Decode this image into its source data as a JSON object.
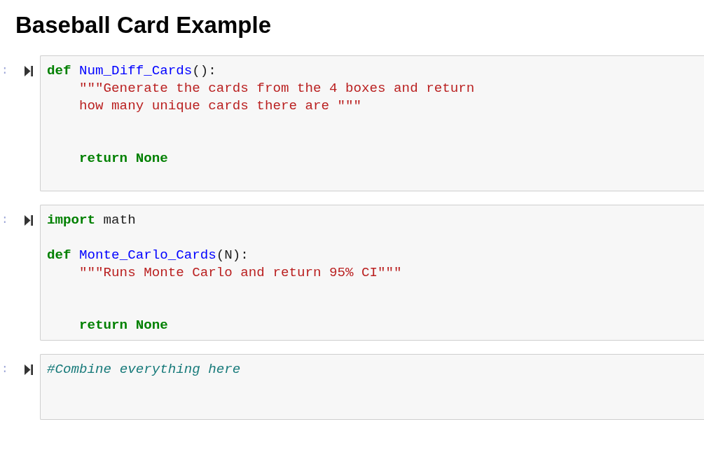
{
  "title": "Baseball Card Example",
  "cells": [
    {
      "prompt": ":",
      "lines": [
        {
          "kind": "code",
          "indented": false,
          "tokens": [
            {
              "kind": "keyword",
              "text": "def"
            },
            {
              "kind": "def_name",
              "text": " Num_Diff_Cards"
            },
            {
              "kind": "plain",
              "text": "():"
            }
          ]
        },
        {
          "kind": "code",
          "indented": true,
          "tokens": [
            {
              "kind": "string",
              "text": "\"\"\"Generate the cards from the 4 boxes and return"
            }
          ]
        },
        {
          "kind": "code",
          "indented": true,
          "tokens": [
            {
              "kind": "string",
              "text": "how many unique cards there are \"\"\""
            }
          ]
        },
        {
          "kind": "blank"
        },
        {
          "kind": "blank"
        },
        {
          "kind": "code",
          "indented": true,
          "tokens": [
            {
              "kind": "keyword",
              "text": "return"
            },
            {
              "kind": "keyword",
              "text": " None"
            }
          ]
        },
        {
          "kind": "blank"
        }
      ]
    },
    {
      "prompt": ":",
      "lines": [
        {
          "kind": "code",
          "indented": false,
          "tokens": [
            {
              "kind": "keyword",
              "text": "import"
            },
            {
              "kind": "plain",
              "text": " math"
            }
          ]
        },
        {
          "kind": "blank"
        },
        {
          "kind": "code",
          "indented": false,
          "tokens": [
            {
              "kind": "keyword",
              "text": "def"
            },
            {
              "kind": "def_name",
              "text": " Monte_Carlo_Cards"
            },
            {
              "kind": "plain",
              "text": "(N):"
            }
          ]
        },
        {
          "kind": "code",
          "indented": true,
          "tokens": [
            {
              "kind": "string",
              "text": "\"\"\"Runs Monte Carlo and return 95% CI\"\"\""
            }
          ]
        },
        {
          "kind": "blank"
        },
        {
          "kind": "blank"
        },
        {
          "kind": "code",
          "indented": true,
          "tokens": [
            {
              "kind": "keyword",
              "text": "return"
            },
            {
              "kind": "keyword",
              "text": " None"
            }
          ]
        }
      ]
    },
    {
      "prompt": ":",
      "lines": [
        {
          "kind": "code",
          "indented": false,
          "tokens": [
            {
              "kind": "comment",
              "text": "#Combine everything here"
            }
          ]
        },
        {
          "kind": "blank"
        },
        {
          "kind": "blank"
        }
      ]
    }
  ]
}
